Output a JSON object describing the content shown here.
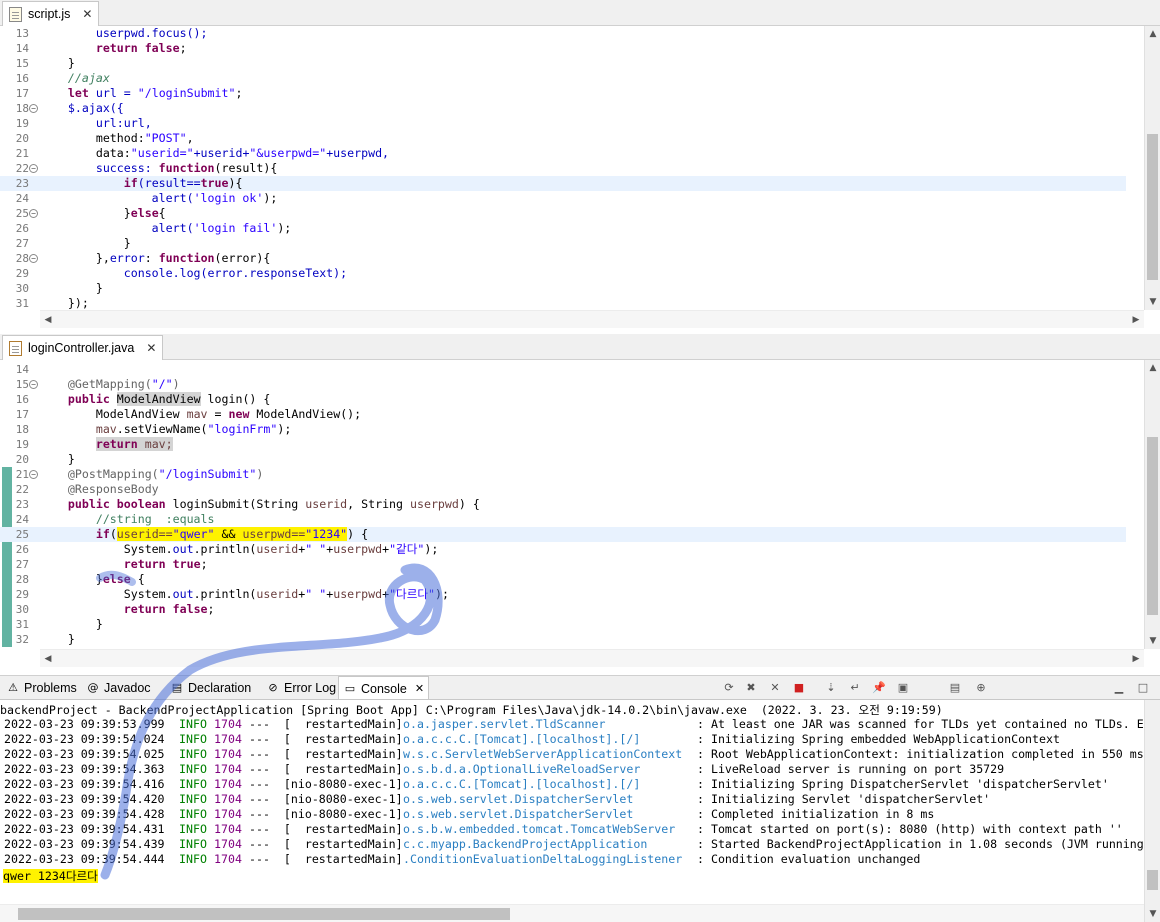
{
  "top_editor": {
    "tab": "script.js",
    "lines": [
      {
        "num": "13",
        "segments": [
          {
            "t": "        userpwd.focus();",
            "c": "fld"
          }
        ]
      },
      {
        "num": "14",
        "segments": [
          {
            "t": "        ",
            "c": ""
          },
          {
            "t": "return false",
            "c": "js-kw"
          },
          {
            "t": ";",
            "c": ""
          }
        ]
      },
      {
        "num": "15",
        "segments": [
          {
            "t": "    }",
            "c": ""
          }
        ]
      },
      {
        "num": "16",
        "segments": [
          {
            "t": "    //ajax",
            "c": "js-cm"
          }
        ]
      },
      {
        "num": "17",
        "segments": [
          {
            "t": "    ",
            "c": ""
          },
          {
            "t": "let",
            "c": "js-kw"
          },
          {
            "t": " url = ",
            "c": "fld"
          },
          {
            "t": "\"/loginSubmit\"",
            "c": "js-str"
          },
          {
            "t": ";",
            "c": ""
          }
        ]
      },
      {
        "num": "18",
        "fold": true,
        "segments": [
          {
            "t": "    $.ajax({",
            "c": "fld"
          }
        ]
      },
      {
        "num": "19",
        "segments": [
          {
            "t": "        url:url,",
            "c": "fld"
          }
        ]
      },
      {
        "num": "20",
        "segments": [
          {
            "t": "        method:",
            "c": ""
          },
          {
            "t": "\"POST\"",
            "c": "js-str"
          },
          {
            "t": ",",
            "c": ""
          }
        ]
      },
      {
        "num": "21",
        "segments": [
          {
            "t": "        data:",
            "c": ""
          },
          {
            "t": "\"userid=\"",
            "c": "js-str"
          },
          {
            "t": "+userid+",
            "c": "fld"
          },
          {
            "t": "\"&userpwd=\"",
            "c": "js-str"
          },
          {
            "t": "+userpwd,",
            "c": "fld"
          }
        ]
      },
      {
        "num": "22",
        "fold": true,
        "segments": [
          {
            "t": "        success: ",
            "c": "fld"
          },
          {
            "t": "function",
            "c": "js-kw"
          },
          {
            "t": "(result){",
            "c": ""
          }
        ]
      },
      {
        "num": "23",
        "current": true,
        "segments": [
          {
            "t": "            ",
            "c": ""
          },
          {
            "t": "if",
            "c": "js-kw"
          },
          {
            "t": "(result==",
            "c": "fld"
          },
          {
            "t": "true",
            "c": "js-kw"
          },
          {
            "t": "){",
            "c": ""
          }
        ]
      },
      {
        "num": "24",
        "segments": [
          {
            "t": "                alert(",
            "c": "fld"
          },
          {
            "t": "'login ok'",
            "c": "js-str"
          },
          {
            "t": ");",
            "c": ""
          }
        ]
      },
      {
        "num": "25",
        "fold": true,
        "segments": [
          {
            "t": "            }",
            "c": ""
          },
          {
            "t": "else",
            "c": "js-kw"
          },
          {
            "t": "{",
            "c": ""
          }
        ]
      },
      {
        "num": "26",
        "segments": [
          {
            "t": "                alert(",
            "c": "fld"
          },
          {
            "t": "'login fail'",
            "c": "js-str"
          },
          {
            "t": ");",
            "c": ""
          }
        ]
      },
      {
        "num": "27",
        "segments": [
          {
            "t": "            }",
            "c": ""
          }
        ]
      },
      {
        "num": "28",
        "fold": true,
        "segments": [
          {
            "t": "        },",
            "c": ""
          },
          {
            "t": "error",
            "c": "fld"
          },
          {
            "t": ": ",
            "c": ""
          },
          {
            "t": "function",
            "c": "js-kw"
          },
          {
            "t": "(error){",
            "c": ""
          }
        ]
      },
      {
        "num": "29",
        "segments": [
          {
            "t": "            console.log(error.responseText);",
            "c": "fld"
          }
        ]
      },
      {
        "num": "30",
        "segments": [
          {
            "t": "        }",
            "c": ""
          }
        ]
      },
      {
        "num": "31",
        "segments": [
          {
            "t": "    });",
            "c": ""
          }
        ]
      }
    ]
  },
  "bottom_editor": {
    "tab": "loginController.java",
    "lines": [
      {
        "num": "14",
        "segments": [
          {
            "t": "",
            "c": ""
          }
        ]
      },
      {
        "num": "15",
        "fold": true,
        "segments": [
          {
            "t": "    ",
            "c": ""
          },
          {
            "t": "@GetMapping(",
            "c": "anno"
          },
          {
            "t": "\"/\"",
            "c": "str"
          },
          {
            "t": ")",
            "c": "anno"
          }
        ]
      },
      {
        "num": "16",
        "segments": [
          {
            "t": "    ",
            "c": ""
          },
          {
            "t": "public",
            "c": "kw"
          },
          {
            "t": " ",
            "c": ""
          },
          {
            "t": "ModelAndView",
            "c": "sel"
          },
          {
            "t": " login() {",
            "c": ""
          }
        ]
      },
      {
        "num": "17",
        "segments": [
          {
            "t": "        ModelAndView ",
            "c": ""
          },
          {
            "t": "mav",
            "c": "var"
          },
          {
            "t": " = ",
            "c": ""
          },
          {
            "t": "new",
            "c": "kw"
          },
          {
            "t": " ModelAndView();",
            "c": ""
          }
        ]
      },
      {
        "num": "18",
        "segments": [
          {
            "t": "        ",
            "c": ""
          },
          {
            "t": "mav",
            "c": "var"
          },
          {
            "t": ".setViewName(",
            "c": ""
          },
          {
            "t": "\"loginFrm\"",
            "c": "str"
          },
          {
            "t": ");",
            "c": ""
          }
        ]
      },
      {
        "num": "19",
        "segments": [
          {
            "t": "        ",
            "c": ""
          },
          {
            "t": "return",
            "c": "kw sel"
          },
          {
            "t": " mav;",
            "c": "var sel"
          }
        ]
      },
      {
        "num": "20",
        "segments": [
          {
            "t": "    }",
            "c": ""
          }
        ]
      },
      {
        "num": "21",
        "fold": true,
        "segments": [
          {
            "t": "    ",
            "c": ""
          },
          {
            "t": "@PostMapping(",
            "c": "anno"
          },
          {
            "t": "\"/loginSubmit\"",
            "c": "str"
          },
          {
            "t": ")",
            "c": "anno"
          }
        ]
      },
      {
        "num": "22",
        "segments": [
          {
            "t": "    ",
            "c": ""
          },
          {
            "t": "@ResponseBody",
            "c": "anno"
          }
        ]
      },
      {
        "num": "23",
        "segments": [
          {
            "t": "    ",
            "c": ""
          },
          {
            "t": "public",
            "c": "kw"
          },
          {
            "t": " ",
            "c": ""
          },
          {
            "t": "boolean",
            "c": "kw"
          },
          {
            "t": " loginSubmit(String ",
            "c": ""
          },
          {
            "t": "userid",
            "c": "var"
          },
          {
            "t": ", String ",
            "c": ""
          },
          {
            "t": "userpwd",
            "c": "var"
          },
          {
            "t": ") {",
            "c": ""
          }
        ]
      },
      {
        "num": "24",
        "segments": [
          {
            "t": "        //string  :equals",
            "c": "cm"
          }
        ]
      },
      {
        "num": "25",
        "current": true,
        "segments": [
          {
            "t": "        ",
            "c": ""
          },
          {
            "t": "if",
            "c": "kw"
          },
          {
            "t": "(",
            "c": ""
          },
          {
            "t": "userid==",
            "c": "var hl"
          },
          {
            "t": "\"qwer\"",
            "c": "str hl"
          },
          {
            "t": " && ",
            "c": "hl"
          },
          {
            "t": "userpwd==",
            "c": "var hl"
          },
          {
            "t": "\"1234\"",
            "c": "str hl"
          },
          {
            "t": ") {",
            "c": ""
          }
        ]
      },
      {
        "num": "26",
        "segments": [
          {
            "t": "            System.",
            "c": ""
          },
          {
            "t": "out",
            "c": "fld"
          },
          {
            "t": ".println(",
            "c": ""
          },
          {
            "t": "userid",
            "c": "var"
          },
          {
            "t": "+",
            "c": ""
          },
          {
            "t": "\" \"",
            "c": "str"
          },
          {
            "t": "+",
            "c": ""
          },
          {
            "t": "userpwd",
            "c": "var"
          },
          {
            "t": "+",
            "c": ""
          },
          {
            "t": "\"같다\"",
            "c": "str"
          },
          {
            "t": ");",
            "c": ""
          }
        ]
      },
      {
        "num": "27",
        "segments": [
          {
            "t": "            ",
            "c": ""
          },
          {
            "t": "return",
            "c": "kw"
          },
          {
            "t": " ",
            "c": ""
          },
          {
            "t": "true",
            "c": "kw"
          },
          {
            "t": ";",
            "c": ""
          }
        ]
      },
      {
        "num": "28",
        "segments": [
          {
            "t": "        }",
            "c": ""
          },
          {
            "t": "else",
            "c": "kw"
          },
          {
            "t": " {",
            "c": ""
          }
        ]
      },
      {
        "num": "29",
        "segments": [
          {
            "t": "            System.",
            "c": ""
          },
          {
            "t": "out",
            "c": "fld"
          },
          {
            "t": ".println(",
            "c": ""
          },
          {
            "t": "userid",
            "c": "var"
          },
          {
            "t": "+",
            "c": ""
          },
          {
            "t": "\" \"",
            "c": "str"
          },
          {
            "t": "+",
            "c": ""
          },
          {
            "t": "userpwd",
            "c": "var"
          },
          {
            "t": "+",
            "c": ""
          },
          {
            "t": "\"다르다\"",
            "c": "str"
          },
          {
            "t": ");",
            "c": ""
          }
        ]
      },
      {
        "num": "30",
        "segments": [
          {
            "t": "            ",
            "c": ""
          },
          {
            "t": "return",
            "c": "kw"
          },
          {
            "t": " ",
            "c": ""
          },
          {
            "t": "false",
            "c": "kw"
          },
          {
            "t": ";",
            "c": ""
          }
        ]
      },
      {
        "num": "31",
        "segments": [
          {
            "t": "        }",
            "c": ""
          }
        ]
      },
      {
        "num": "32",
        "segments": [
          {
            "t": "    }",
            "c": ""
          }
        ]
      }
    ]
  },
  "view_tabs": [
    {
      "label": "Problems",
      "icon": "problems-icon",
      "glyph": "⚠"
    },
    {
      "label": "Javadoc",
      "icon": "javadoc-icon",
      "glyph": "@"
    },
    {
      "label": "Declaration",
      "icon": "declaration-icon",
      "glyph": "▤"
    },
    {
      "label": "Error Log",
      "icon": "error-log-icon",
      "glyph": "⊘"
    },
    {
      "label": "Console",
      "icon": "console-icon",
      "glyph": "▭",
      "active": true
    }
  ],
  "console": {
    "status": "backendProject - BackendProjectApplication [Spring Boot App] C:\\Program Files\\Java\\jdk-14.0.2\\bin\\javaw.exe  (2022. 3. 23. 오전 9:19:59)",
    "rows": [
      {
        "ts": "2022-03-23 09:39:53.999",
        "level": "INFO",
        "pid": "1704",
        "thread": "---  [  restartedMain]",
        "logger": "o.a.jasper.servlet.TldScanner",
        "msg": ": At least one JAR was scanned for TLDs yet contained no TLDs. En"
      },
      {
        "ts": "2022-03-23 09:39:54.024",
        "level": "INFO",
        "pid": "1704",
        "thread": "---  [  restartedMain]",
        "logger": "o.a.c.c.C.[Tomcat].[localhost].[/]",
        "msg": ": Initializing Spring embedded WebApplicationContext"
      },
      {
        "ts": "2022-03-23 09:39:54.025",
        "level": "INFO",
        "pid": "1704",
        "thread": "---  [  restartedMain]",
        "logger": "w.s.c.ServletWebServerApplicationContext",
        "msg": ": Root WebApplicationContext: initialization completed in 550 ms"
      },
      {
        "ts": "2022-03-23 09:39:54.363",
        "level": "INFO",
        "pid": "1704",
        "thread": "---  [  restartedMain]",
        "logger": "o.s.b.d.a.OptionalLiveReloadServer",
        "msg": ": LiveReload server is running on port 35729"
      },
      {
        "ts": "2022-03-23 09:39:54.416",
        "level": "INFO",
        "pid": "1704",
        "thread": "---  [nio-8080-exec-1]",
        "logger": "o.a.c.c.C.[Tomcat].[localhost].[/]",
        "msg": ": Initializing Spring DispatcherServlet 'dispatcherServlet'"
      },
      {
        "ts": "2022-03-23 09:39:54.420",
        "level": "INFO",
        "pid": "1704",
        "thread": "---  [nio-8080-exec-1]",
        "logger": "o.s.web.servlet.DispatcherServlet",
        "msg": ": Initializing Servlet 'dispatcherServlet'"
      },
      {
        "ts": "2022-03-23 09:39:54.428",
        "level": "INFO",
        "pid": "1704",
        "thread": "---  [nio-8080-exec-1]",
        "logger": "o.s.web.servlet.DispatcherServlet",
        "msg": ": Completed initialization in 8 ms"
      },
      {
        "ts": "2022-03-23 09:39:54.431",
        "level": "INFO",
        "pid": "1704",
        "thread": "---  [  restartedMain]",
        "logger": "o.s.b.w.embedded.tomcat.TomcatWebServer",
        "msg": ": Tomcat started on port(s): 8080 (http) with context path ''"
      },
      {
        "ts": "2022-03-23 09:39:54.439",
        "level": "INFO",
        "pid": "1704",
        "thread": "---  [  restartedMain]",
        "logger": "c.c.myapp.BackendProjectApplication",
        "msg": ": Started BackendProjectApplication in 1.08 seconds (JVM running"
      },
      {
        "ts": "2022-03-23 09:39:54.444",
        "level": "INFO",
        "pid": "1704",
        "thread": "---  [  restartedMain]",
        "logger": ".ConditionEvaluationDeltaLoggingListener",
        "msg": ": Condition evaluation unchanged"
      }
    ],
    "output": "qwer 1234다르다"
  },
  "toolbar_icons": [
    "sync-icon",
    "terminate-icon",
    "remove-all-icon",
    "stop-icon",
    "scroll-lock-icon",
    "word-wrap-icon",
    "pin-icon",
    "display-selected-icon",
    "open-console-icon",
    "new-console-icon",
    "minimize-icon",
    "maximize-icon"
  ],
  "colors": {
    "highlight": "#fff200",
    "annotation_stroke": "#4a6fd8",
    "current_line": "#e8f2fe"
  }
}
